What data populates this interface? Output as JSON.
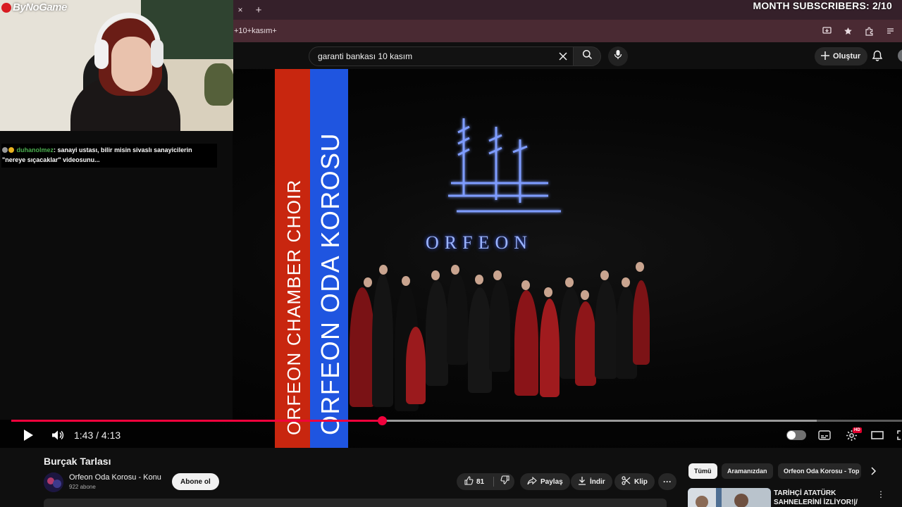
{
  "stream_overlay": {
    "logo_text": "ByNoGame",
    "subscribers_goal": "MONTH SUBSCRIBERS: 2/10"
  },
  "browser": {
    "tab_close": "×",
    "tab_new": "+",
    "url_fragment": "+10+kasım+"
  },
  "youtube": {
    "search_value": "garanti bankası 10 kasım",
    "create_label": "Oluştur"
  },
  "chat": {
    "username": "duhanolmez",
    "message": ": sanayi ustası, bilir misin sivaslı sanayicilerin \"nereye sıçacaklar\" videosunu..."
  },
  "video_frame": {
    "red_band_text": "ORFEON CHAMBER CHOIR",
    "blue_band_text": "ORFEON ODA KOROSU",
    "emblem_text": "ORFEON"
  },
  "player": {
    "time_display": "1:43 / 4:13",
    "progress_fraction": 0.416,
    "buffer_fraction": 0.904,
    "hd_label": "HD",
    "colors": {
      "progress": "#f0023c"
    }
  },
  "video_info": {
    "title": "Burçak Tarlası",
    "channel_name": "Orfeon Oda Korosu - Konu",
    "channel_subscribers": "922 abone",
    "subscribe_label": "Abone ol",
    "like_count": "81",
    "share_label": "Paylaş",
    "download_label": "İndir",
    "clip_label": "Klip",
    "more_label": "···"
  },
  "recommendations": {
    "chips": [
      "Tümü",
      "Aramanızdan",
      "Orfeon Oda Korosu - Top"
    ],
    "first_title": "TARİHÇİ ATATÜRK SAHNELERİNİ İZLİYOR!|/"
  }
}
